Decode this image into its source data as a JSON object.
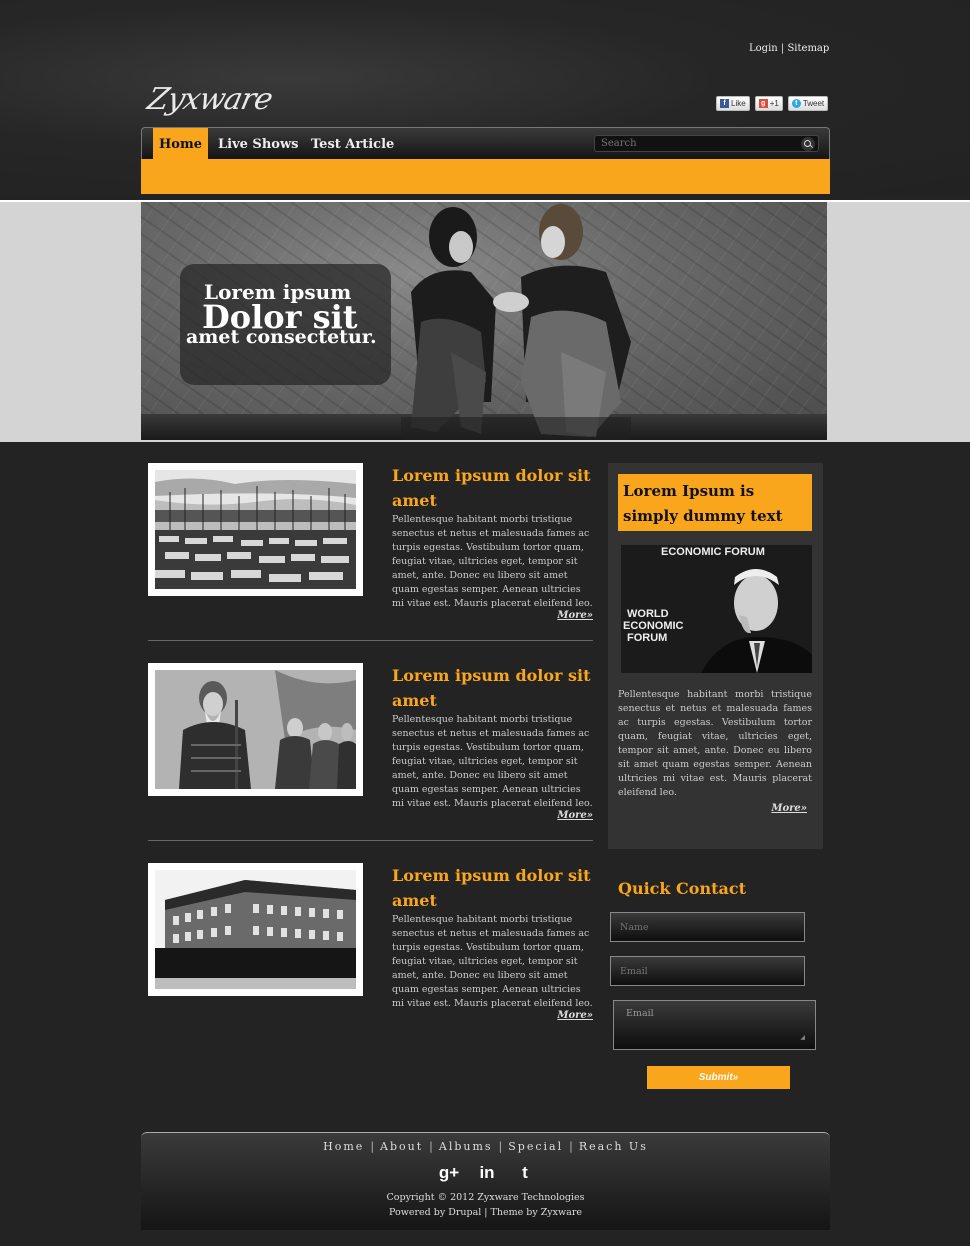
{
  "header": {
    "login": "Login",
    "separator": "|",
    "sitemap": "Sitemap",
    "logo": "Zyxware",
    "social": {
      "like": "Like",
      "plusone": "+1",
      "tweet": "Tweet"
    }
  },
  "nav": {
    "items": [
      {
        "label": "Home",
        "active": true
      },
      {
        "label": "Live Shows"
      },
      {
        "label": "Test Article"
      }
    ],
    "search_placeholder": "Search"
  },
  "banner": {
    "line1": "Lorem ipsum",
    "line2": "Dolor sit",
    "line3": "amet consectetur."
  },
  "articles": [
    {
      "title": "Lorem ipsum dolor sit amet",
      "body": "Pellentesque habitant morbi tristique senectus et netus et malesuada fames ac turpis egestas. Vestibulum tortor quam, feugiat vitae, ultricies eget, tempor sit amet, ante. Donec eu libero sit amet quam egestas semper. Aenean ultricies mi vitae est. Mauris placerat eleifend leo.",
      "more": "More»",
      "image": "harbor-boats"
    },
    {
      "title": "Lorem ipsum dolor sit amet",
      "body": "Pellentesque habitant morbi tristique senectus et netus et malesuada fames ac turpis egestas. Vestibulum tortor quam, feugiat vitae, ultricies eget, tempor sit amet, ante. Donec eu libero sit amet quam egestas semper. Aenean ultricies mi vitae est. Mauris placerat eleifend leo.",
      "more": "More»",
      "image": "statues"
    },
    {
      "title": "Lorem ipsum dolor sit amet",
      "body": "Pellentesque habitant morbi tristique senectus et netus et malesuada fames ac turpis egestas. Vestibulum tortor quam, feugiat vitae, ultricies eget, tempor sit amet, ante. Donec eu libero sit amet quam egestas semper. Aenean ultricies mi vitae est. Mauris placerat eleifend leo.",
      "more": "More»",
      "image": "brick-building"
    }
  ],
  "sidebar": {
    "heading": "Lorem Ipsum is simply dummy text",
    "image_texts": {
      "top": "ECONOMIC FORUM",
      "w1": "WORLD",
      "w2": "ECONOMIC",
      "w3": "FORUM"
    },
    "body": "Pellentesque habitant morbi tristique senectus et netus et malesuada fames ac turpis egestas. Vestibulum tortor quam, feugiat vitae, ultricies eget, tempor sit amet, ante. Donec eu libero sit amet quam egestas semper. Aenean ultricies mi vitae est. Mauris placerat eleifend leo.",
    "more": "More»"
  },
  "quick_contact": {
    "title": "Quick Contact",
    "name_placeholder": "Name",
    "email_placeholder": "Email",
    "message_placeholder": "Email",
    "submit": "Submit»"
  },
  "footer": {
    "links": [
      "Home",
      "About",
      "Albums",
      "Special",
      "Reach Us"
    ],
    "icons": {
      "google": "g+",
      "linkedin": "in",
      "twitter": "t"
    },
    "copyright": "Copyright © 2012 Zyxware Technologies",
    "powered": "Powered by Drupal | Theme by Zyxware"
  },
  "colors": {
    "accent": "#f9a61c",
    "background": "#232323",
    "band": "#d4d4d4"
  }
}
